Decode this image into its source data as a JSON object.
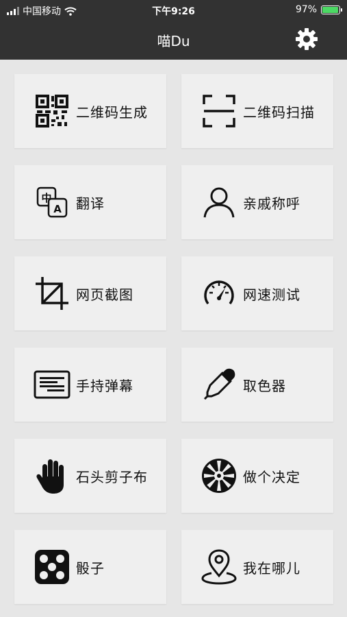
{
  "status_bar": {
    "carrier": "中国移动",
    "time": "下午9:26",
    "battery_text": "97%",
    "battery_level": 0.97,
    "battery_color": "#4cd964"
  },
  "header": {
    "title": "喵Du",
    "settings_icon": "gear-icon",
    "background": "#323232"
  },
  "tiles": [
    {
      "label": "二维码生成",
      "icon": "qr-code-icon"
    },
    {
      "label": "二维码扫描",
      "icon": "scan-frame-icon"
    },
    {
      "label": "翻译",
      "icon": "translate-icon"
    },
    {
      "label": "亲戚称呼",
      "icon": "person-icon"
    },
    {
      "label": "网页截图",
      "icon": "crop-icon"
    },
    {
      "label": "网速测试",
      "icon": "speedometer-icon"
    },
    {
      "label": "手持弹幕",
      "icon": "text-lines-icon"
    },
    {
      "label": "取色器",
      "icon": "eyedropper-icon"
    },
    {
      "label": "石头剪子布",
      "icon": "hand-icon"
    },
    {
      "label": "做个决定",
      "icon": "wheel-icon"
    },
    {
      "label": "骰子",
      "icon": "dice-icon"
    },
    {
      "label": "我在哪儿",
      "icon": "location-pin-icon"
    }
  ]
}
